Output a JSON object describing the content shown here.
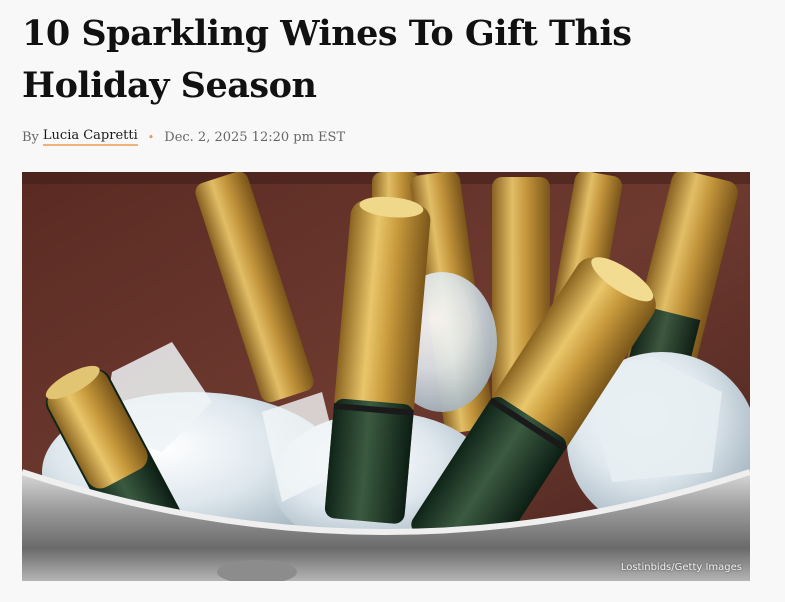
{
  "article": {
    "headline": "10 Sparkling Wines To Gift This Holiday Season",
    "byline": {
      "prefix": "By",
      "author": "Lucia Capretti",
      "separator": "•",
      "date": "Dec. 2, 2025 12:20 pm EST"
    },
    "hero_image": {
      "subject": "champagne bottles in ice bucket",
      "credit": "Lostinbids/Getty Images"
    }
  },
  "colors": {
    "accent_underline": "#f0b27a",
    "separator_dot": "#e39a5a",
    "background": "#f8f8f8"
  }
}
